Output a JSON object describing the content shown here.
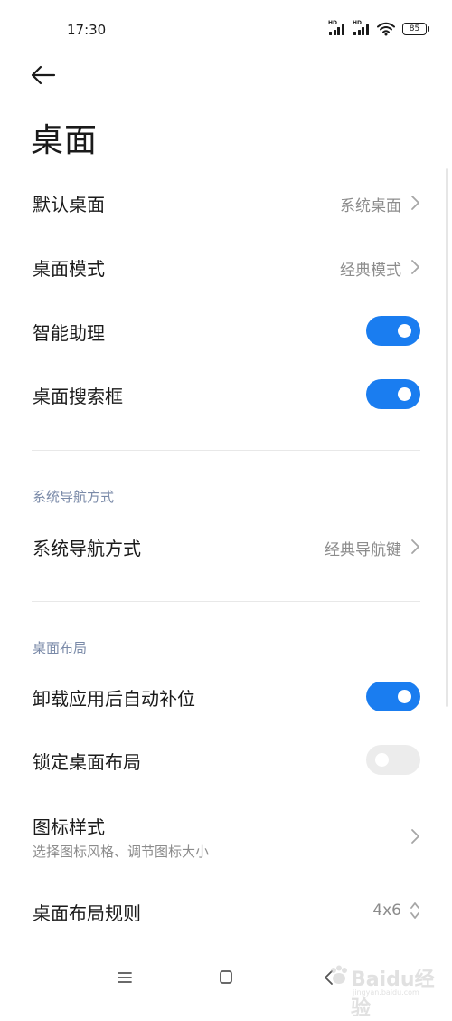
{
  "status_bar": {
    "time": "17:30",
    "hd_label_1": "HD",
    "hd_label_2": "HD",
    "battery": "85"
  },
  "header": {
    "title": "桌面"
  },
  "rows": {
    "default_launcher": {
      "label": "默认桌面",
      "value": "系统桌面"
    },
    "launcher_mode": {
      "label": "桌面模式",
      "value": "经典模式"
    },
    "smart_assistant": {
      "label": "智能助理",
      "toggle": "on"
    },
    "search_box": {
      "label": "桌面搜索框",
      "toggle": "on"
    },
    "nav_method": {
      "label": "系统导航方式",
      "value": "经典导航键"
    },
    "auto_fill": {
      "label": "卸载应用后自动补位",
      "toggle": "on"
    },
    "lock_layout": {
      "label": "锁定桌面布局",
      "toggle": "off"
    },
    "icon_style": {
      "label": "图标样式",
      "subtitle": "选择图标风格、调节图标大小"
    },
    "layout_grid": {
      "label": "桌面布局规则",
      "value": "4x6"
    }
  },
  "sections": {
    "navigation": "系统导航方式",
    "layout": "桌面布局"
  },
  "colors": {
    "accent": "#1a7df0",
    "toggle_off": "#ececec",
    "section_header": "#7a8aa8",
    "secondary_text": "#8c8c8c"
  },
  "icons": {
    "back": "arrow-left-icon",
    "chevron": "chevron-right-icon",
    "updown": "chevron-up-down-icon",
    "nav_menu": "menu-icon",
    "nav_home": "square-icon",
    "nav_back": "chevron-left-icon"
  },
  "watermark": {
    "text": "Baidu经验",
    "sub": "jingyan.baidu.com"
  }
}
